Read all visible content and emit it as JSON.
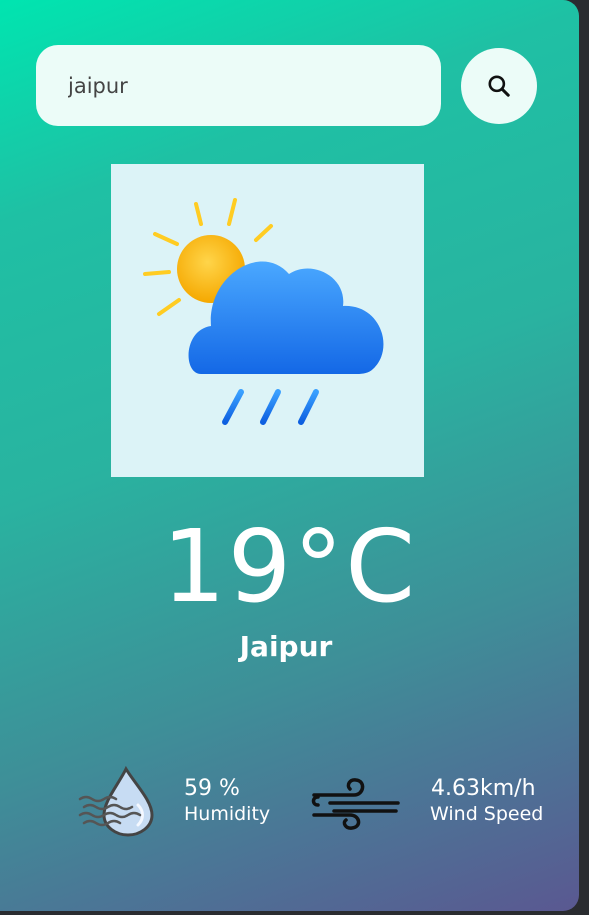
{
  "search": {
    "value": "jaipur"
  },
  "weather": {
    "condition_icon": "sun-cloud-rain-icon",
    "temperature": "19°C",
    "city": "Jaipur"
  },
  "details": {
    "humidity": {
      "value": "59 %",
      "label": "Humidity",
      "icon": "humidity-icon"
    },
    "wind": {
      "value": "4.63km/h",
      "label": "Wind Speed",
      "icon": "wind-icon"
    }
  },
  "colors": {
    "gradient_start": "#00e5b0",
    "gradient_end": "#5a5891",
    "search_bg": "#ecfcf8",
    "text": "#ffffff"
  }
}
